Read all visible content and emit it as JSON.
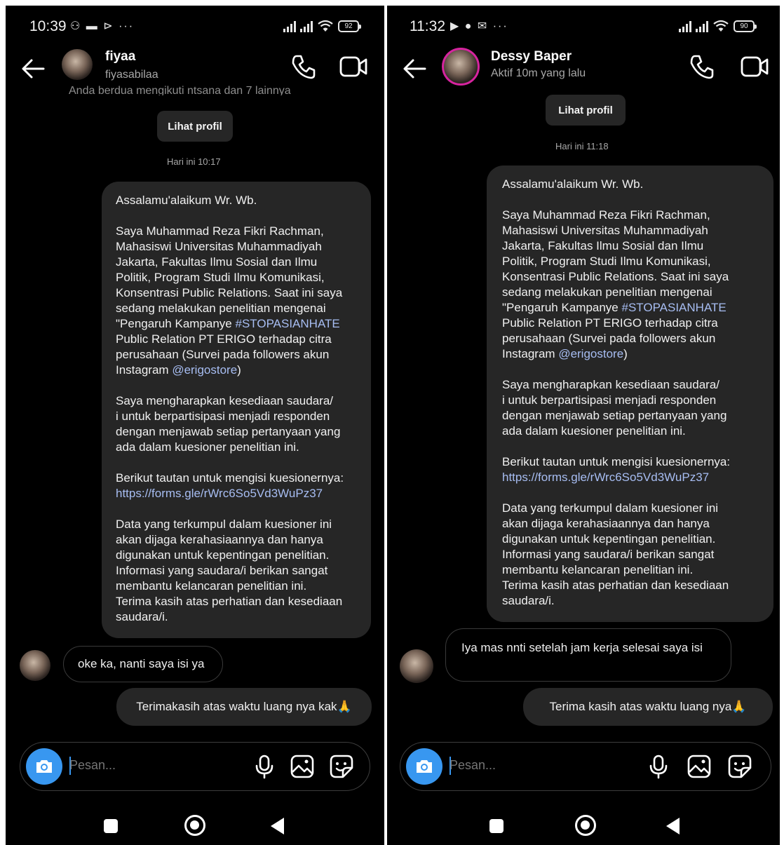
{
  "screens": [
    {
      "status": {
        "time": "10:39",
        "icons": "⚇ ▬ ⊳ ···",
        "battery": "92"
      },
      "header": {
        "name": "fiyaa",
        "subtitle": "fiyasabilaa"
      },
      "clipped_line": "Anda berdua mengikuti ntsana dan 7 lainnya",
      "view_profile": "Lihat profil",
      "timestamp": "Hari ini 10:17",
      "message": {
        "p1": "Assalamu'alaikum Wr. Wb.",
        "p2": "Saya Muhammad Reza Fikri Rachman,\nMahasiswi Universitas Muhammadiyah\nJakarta, Fakultas Ilmu Sosial dan Ilmu\nPolitik, Program Studi Ilmu Komunikasi,\nKonsentrasi Public Relations. Saat ini saya\nsedang melakukan penelitian mengenai\n\"Pengaruh Kampanye ",
        "hashtag": "#STOPASIANHATE",
        "p2b": "\nPublic Relation PT ERIGO terhadap citra\nperusahaan (Survei pada followers akun\nInstagram ",
        "mention": "@erigostore",
        "p2c": ")",
        "p3": "Saya mengharapkan kesediaan saudara/\ni untuk berpartisipasi menjadi responden\ndengan menjawab setiap pertanyaan yang\nada dalam kuesioner penelitian ini.",
        "p4": "Berikut tautan untuk mengisi kuesionernya:",
        "url": "https://forms.gle/rWrc6So5Vd3WuPz37",
        "p5": "Data yang terkumpul dalam kuesioner ini\nakan dijaga kerahasiaannya dan hanya\ndigunakan untuk kepentingan penelitian.\nInformasi yang saudara/i berikan sangat\nmembantu kelancaran penelitian ini.\nTerima kasih atas perhatian dan kesediaan\nsaudara/i."
      },
      "reply": "oke ka, nanti saya isi ya",
      "last_message": "Terimakasih atas waktu luang nya kak🙏",
      "composer_placeholder": "Pesan..."
    },
    {
      "status": {
        "time": "11:32",
        "icons": "▶ ● ✉ ···",
        "battery": "90"
      },
      "header": {
        "name": "Dessy Baper",
        "subtitle": "Aktif 10m yang lalu"
      },
      "view_profile": "Lihat profil",
      "timestamp": "Hari ini 11:18",
      "message": {
        "p1": "Assalamu'alaikum Wr. Wb.",
        "p2": "Saya Muhammad Reza Fikri Rachman,\nMahasiswi Universitas Muhammadiyah\nJakarta, Fakultas Ilmu Sosial dan Ilmu\nPolitik, Program Studi Ilmu Komunikasi,\nKonsentrasi Public Relations. Saat ini saya\nsedang melakukan penelitian mengenai\n\"Pengaruh Kampanye ",
        "hashtag": "#STOPASIANHATE",
        "p2b": "\nPublic Relation PT ERIGO terhadap citra\nperusahaan (Survei pada followers akun\nInstagram ",
        "mention": "@erigostore",
        "p2c": ")",
        "p3": "Saya mengharapkan kesediaan saudara/\ni untuk berpartisipasi menjadi responden\ndengan menjawab setiap pertanyaan yang\nada dalam kuesioner penelitian ini.",
        "p4": "Berikut tautan untuk mengisi kuesionernya:",
        "url": "https://forms.gle/rWrc6So5Vd3WuPz37",
        "p5": "Data yang terkumpul dalam kuesioner ini\nakan dijaga kerahasiaannya dan hanya\ndigunakan untuk kepentingan penelitian.\nInformasi yang saudara/i berikan sangat\nmembantu kelancaran penelitian ini.\nTerima kasih atas perhatian dan kesediaan\nsaudara/i."
      },
      "reply": "Iya mas nnti setelah jam kerja selesai saya isi",
      "last_message": "Terima kasih atas waktu luang nya🙏",
      "composer_placeholder": "Pesan..."
    }
  ],
  "icons": {
    "back": "arrow-left-icon",
    "call": "phone-icon",
    "video": "video-camera-icon",
    "camera": "camera-icon",
    "mic": "microphone-icon",
    "gallery": "gallery-icon",
    "sticker": "sticker-icon"
  },
  "colors": {
    "background": "#000000",
    "bubble": "#262626",
    "accent": "#3897f0",
    "link": "#a7bdf2"
  }
}
